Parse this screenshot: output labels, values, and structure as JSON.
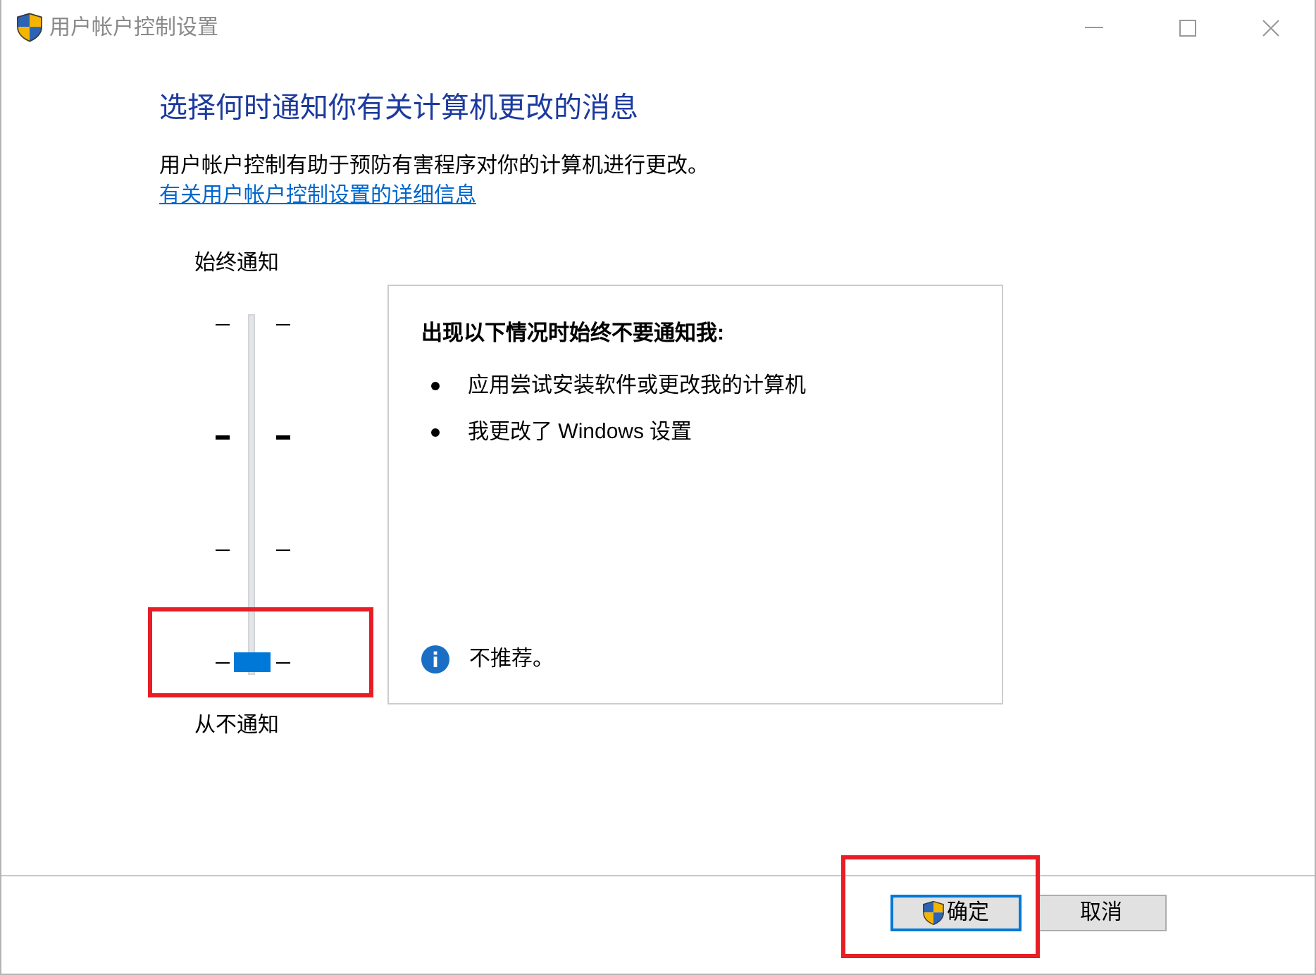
{
  "window": {
    "title": "用户帐户控制设置"
  },
  "heading": "选择何时通知你有关计算机更改的消息",
  "description": "用户帐户控制有助于预防有害程序对你的计算机进行更改。",
  "link": "有关用户帐户控制设置的详细信息",
  "slider": {
    "top_label": "始终通知",
    "bottom_label": "从不通知",
    "level": 0,
    "highlighted": true,
    "ticks": [
      {
        "bold": false
      },
      {
        "bold": true
      },
      {
        "bold": false
      },
      {
        "bold": false
      }
    ]
  },
  "panel": {
    "heading": "出现以下情况时始终不要通知我:",
    "items": [
      "应用尝试安装软件或更改我的计算机",
      "我更改了 Windows 设置"
    ],
    "note": "不推荐。"
  },
  "buttons": [
    {
      "label": "确定",
      "default": true,
      "shield": true,
      "highlighted": true
    },
    {
      "label": "取消",
      "default": false,
      "shield": false,
      "highlighted": false
    }
  ]
}
